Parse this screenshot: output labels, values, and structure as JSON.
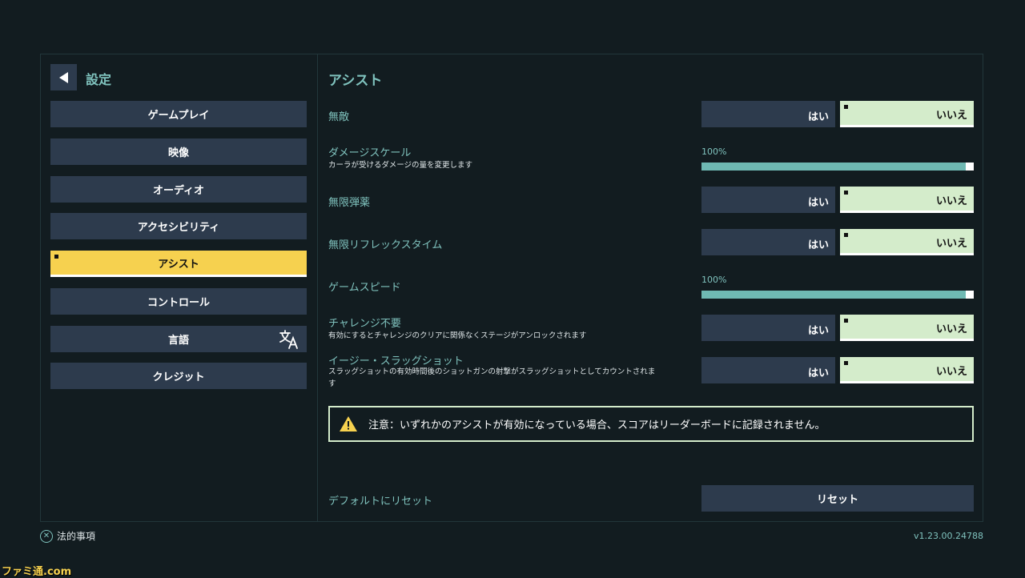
{
  "sidebar": {
    "title": "設定",
    "items": [
      {
        "label": "ゲームプレイ"
      },
      {
        "label": "映像"
      },
      {
        "label": "オーディオ"
      },
      {
        "label": "アクセシビリティ"
      },
      {
        "label": "アシスト",
        "active": true
      },
      {
        "label": "コントロール"
      },
      {
        "label": "言語"
      },
      {
        "label": "クレジット"
      }
    ]
  },
  "main": {
    "title": "アシスト",
    "yes_label": "はい",
    "no_label": "いいえ",
    "options": {
      "invincible": {
        "label": "無敵",
        "value": "いいえ"
      },
      "damage_scale": {
        "label": "ダメージスケール",
        "desc": "カーラが受けるダメージの量を変更します",
        "value_text": "100%",
        "value": 100
      },
      "infinite_ammo": {
        "label": "無限弾薬",
        "value": "いいえ"
      },
      "infinite_reflex": {
        "label": "無限リフレックスタイム",
        "value": "いいえ"
      },
      "game_speed": {
        "label": "ゲームスピード",
        "value_text": "100%",
        "value": 100
      },
      "no_challenge": {
        "label": "チャレンジ不要",
        "desc": "有効にするとチャレンジのクリアに関係なくステージがアンロックされます",
        "value": "いいえ"
      },
      "easy_slug": {
        "label": "イージー・スラッグショット",
        "desc": "スラッグショットの有効時間後のショットガンの射撃がスラッグショットとしてカウントされます",
        "value": "いいえ"
      }
    },
    "notice": "注意：いずれかのアシストが有効になっている場合、スコアはリーダーボードに記録されません。",
    "reset_label": "デフォルトにリセット",
    "reset_button": "リセット"
  },
  "footer": {
    "legal_label": "法的事項",
    "version": "v1.23.00.24788",
    "watermark": "ファミ通.com"
  },
  "colors": {
    "accent": "#7fc2bd",
    "active": "#f6d14f",
    "selected": "#d4eccb",
    "panel": "#2d3b4d",
    "background": "#121c20"
  }
}
